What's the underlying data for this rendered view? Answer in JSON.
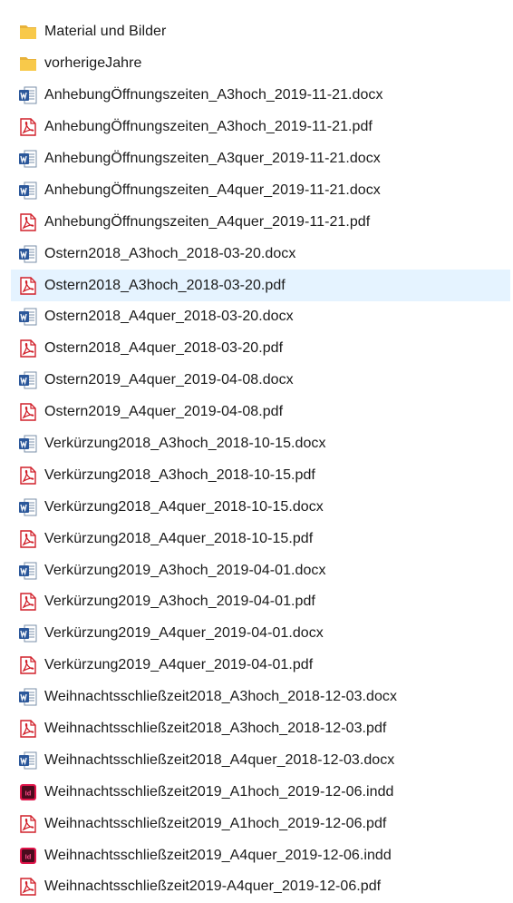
{
  "explorer": {
    "selected_index": 8,
    "items": [
      {
        "name": "Material und Bilder",
        "type": "folder"
      },
      {
        "name": "vorherigeJahre",
        "type": "folder"
      },
      {
        "name": "AnhebungÖffnungszeiten_A3hoch_2019-11-21.docx",
        "type": "docx"
      },
      {
        "name": "AnhebungÖffnungszeiten_A3hoch_2019-11-21.pdf",
        "type": "pdf"
      },
      {
        "name": "AnhebungÖffnungszeiten_A3quer_2019-11-21.docx",
        "type": "docx"
      },
      {
        "name": "AnhebungÖffnungszeiten_A4quer_2019-11-21.docx",
        "type": "docx"
      },
      {
        "name": "AnhebungÖffnungszeiten_A4quer_2019-11-21.pdf",
        "type": "pdf"
      },
      {
        "name": "Ostern2018_A3hoch_2018-03-20.docx",
        "type": "docx"
      },
      {
        "name": "Ostern2018_A3hoch_2018-03-20.pdf",
        "type": "pdf"
      },
      {
        "name": "Ostern2018_A4quer_2018-03-20.docx",
        "type": "docx"
      },
      {
        "name": "Ostern2018_A4quer_2018-03-20.pdf",
        "type": "pdf"
      },
      {
        "name": "Ostern2019_A4quer_2019-04-08.docx",
        "type": "docx"
      },
      {
        "name": "Ostern2019_A4quer_2019-04-08.pdf",
        "type": "pdf"
      },
      {
        "name": "Verkürzung2018_A3hoch_2018-10-15.docx",
        "type": "docx"
      },
      {
        "name": "Verkürzung2018_A3hoch_2018-10-15.pdf",
        "type": "pdf"
      },
      {
        "name": "Verkürzung2018_A4quer_2018-10-15.docx",
        "type": "docx"
      },
      {
        "name": "Verkürzung2018_A4quer_2018-10-15.pdf",
        "type": "pdf"
      },
      {
        "name": "Verkürzung2019_A3hoch_2019-04-01.docx",
        "type": "docx"
      },
      {
        "name": "Verkürzung2019_A3hoch_2019-04-01.pdf",
        "type": "pdf"
      },
      {
        "name": "Verkürzung2019_A4quer_2019-04-01.docx",
        "type": "docx"
      },
      {
        "name": "Verkürzung2019_A4quer_2019-04-01.pdf",
        "type": "pdf"
      },
      {
        "name": "Weihnachtsschließzeit2018_A3hoch_2018-12-03.docx",
        "type": "docx"
      },
      {
        "name": "Weihnachtsschließzeit2018_A3hoch_2018-12-03.pdf",
        "type": "pdf"
      },
      {
        "name": "Weihnachtsschließzeit2018_A4quer_2018-12-03.docx",
        "type": "docx"
      },
      {
        "name": "Weihnachtsschließzeit2019_A1hoch_2019-12-06.indd",
        "type": "indd"
      },
      {
        "name": "Weihnachtsschließzeit2019_A1hoch_2019-12-06.pdf",
        "type": "pdf"
      },
      {
        "name": "Weihnachtsschließzeit2019_A4quer_2019-12-06.indd",
        "type": "indd"
      },
      {
        "name": "Weihnachtsschließzeit2019-A4quer_2019-12-06.pdf",
        "type": "pdf"
      }
    ]
  },
  "icons": {
    "folder": "folder-icon",
    "docx": "word-document-icon",
    "pdf": "pdf-document-icon",
    "indd": "indesign-document-icon"
  },
  "colors": {
    "selection": "#e5f3ff",
    "folder": "#f8c94a",
    "word": "#2b579a",
    "pdf": "#d1202a",
    "indesign": "#e0144a"
  }
}
